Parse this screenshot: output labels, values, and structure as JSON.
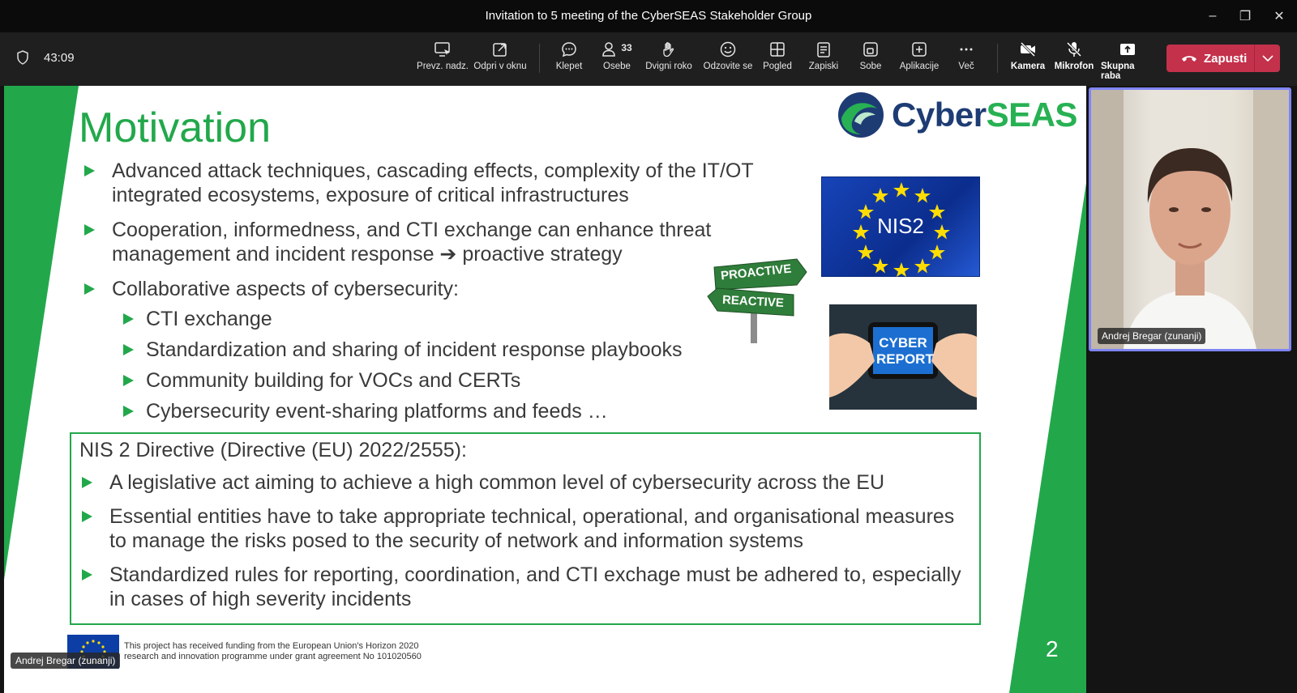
{
  "window": {
    "title": "Invitation to 5 meeting of the CyberSEAS Stakeholder Group",
    "minimize": "–",
    "restore": "❐",
    "close": "✕"
  },
  "toolbar": {
    "timer": "43:09",
    "buttons": {
      "prevz": "Prevz. nadz.",
      "odpri": "Odpri v oknu",
      "klepet": "Klepet",
      "osebe": "Osebe",
      "osebe_count": "33",
      "dvigni": "Dvigni roko",
      "odzovite": "Odzovite se",
      "pogled": "Pogled",
      "zapiski": "Zapiski",
      "sobe": "Sobe",
      "aplikacije": "Aplikacije",
      "vec": "Več",
      "kamera": "Kamera",
      "mikrofon": "Mikrofon",
      "skupna": "Skupna raba"
    },
    "leave_label": "Zapusti"
  },
  "slide": {
    "title": "Motivation",
    "logo_cyber": "Cyber",
    "logo_seas": "SEAS",
    "bullets": [
      "Advanced attack techniques, cascading effects, complexity of the IT/OT integrated ecosystems, exposure of critical infrastructures",
      "Cooperation, informedness, and CTI exchange can enhance threat management and incident response ➔ proactive strategy",
      "Collaborative aspects of cybersecurity:"
    ],
    "sub_bullets": [
      "CTI exchange",
      "Standardization and sharing of incident response playbooks",
      "Community building for VOCs and CERTs",
      "Cybersecurity event-sharing platforms and feeds …"
    ],
    "nis_heading": "NIS 2 Directive (Directive (EU) 2022/2555):",
    "nis_bullets": [
      "A legislative act aiming to achieve a high common level of cybersecurity across the EU",
      "Essential entities have to take appropriate technical, operational, and organisational measures to manage the risks posed to the security of network and information systems",
      "Standardized rules for reporting, coordination, and CTI exchage must be adhered to, especially in cases of high severity incidents"
    ],
    "nis2_label": "NIS2",
    "sign_proactive": "PROACTIVE",
    "sign_reactive": "REACTIVE",
    "cyber_report_line1": "CYBER",
    "cyber_report_line2": "REPORT",
    "footer_line1": "This project has received funding from the European Union's Horizon 2020",
    "footer_line2": "research and innovation programme under grant agreement No 101020560",
    "page_number": "2"
  },
  "presenter": {
    "name": "Andrej Bregar (zunanji)",
    "tile_name": "Andrej Bregar (zunanji)"
  },
  "colors": {
    "accent_green": "#22a84b",
    "leave_red": "#c4314b",
    "tile_border": "#7f85f5"
  }
}
